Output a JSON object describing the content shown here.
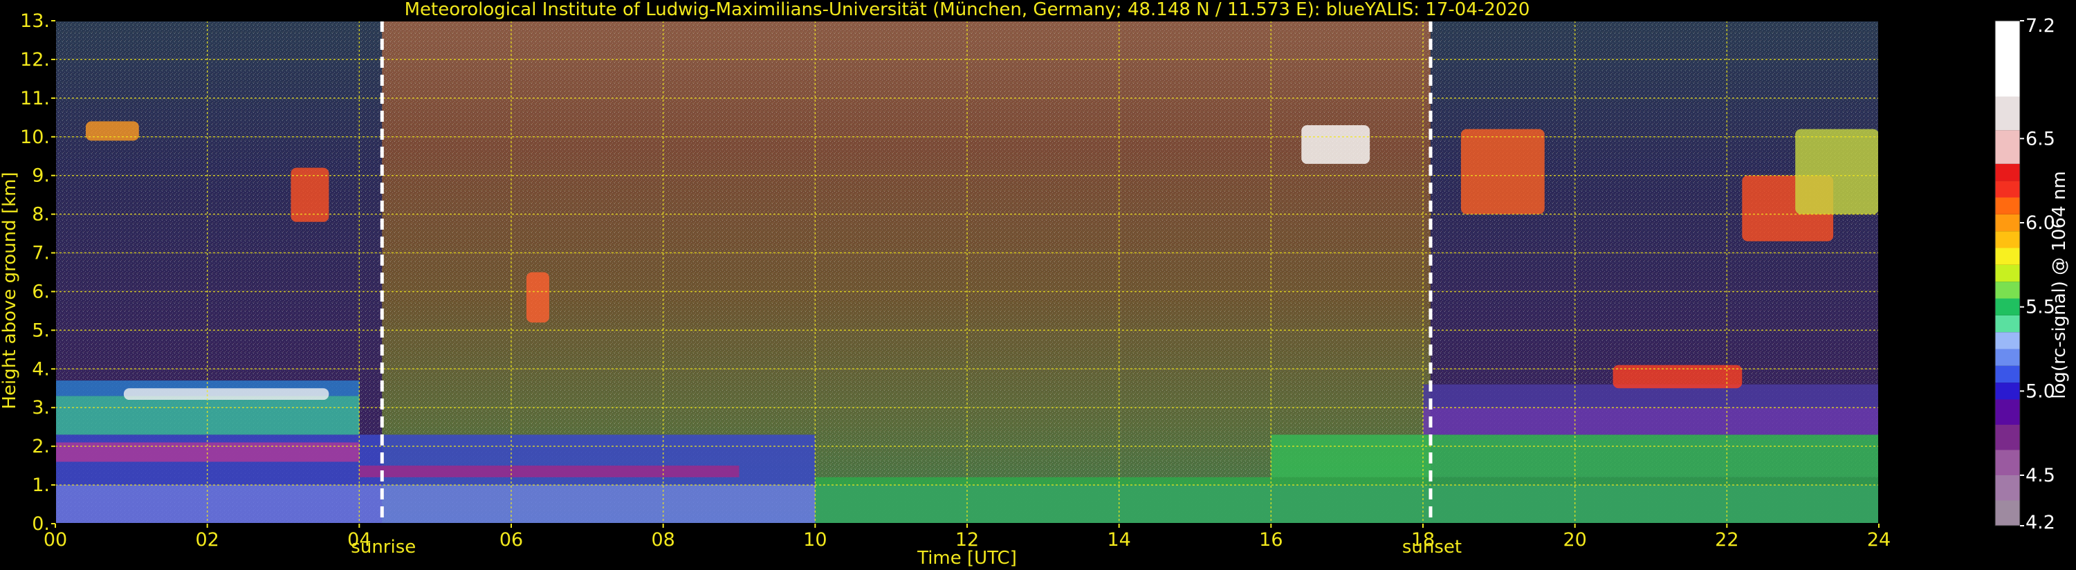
{
  "chart_data": {
    "type": "heatmap",
    "title": "Meteorological Institute of Ludwig-Maximilians-Universität (München, Germany; 48.148 N / 11.573 E):    blueYALIS: 17-04-2020",
    "xlabel": "Time [UTC]",
    "ylabel": "Height above ground [km]",
    "xlim": [
      0,
      24
    ],
    "ylim": [
      0,
      13
    ],
    "x_ticks": [
      "00",
      "02",
      "04",
      "06",
      "08",
      "10",
      "12",
      "14",
      "16",
      "18",
      "20",
      "22",
      "24"
    ],
    "y_ticks": [
      "0.",
      "1.",
      "2.",
      "3.",
      "4.",
      "5.",
      "6.",
      "7.",
      "8.",
      "9.",
      "10.",
      "11.",
      "12.",
      "13."
    ],
    "grid": true,
    "events": [
      {
        "label": "sunrise",
        "x": 4.3
      },
      {
        "label": "sunset",
        "x": 18.1
      }
    ],
    "colorbar": {
      "label": "log(rc-signal) @ 1064 nm",
      "range": [
        4.2,
        7.2
      ],
      "ticks": [
        "4.2",
        "4.5",
        "5.0",
        "5.5",
        "6.0",
        "6.5",
        "7.2"
      ]
    },
    "colors": {
      "text": "#f2e81c",
      "grid": "#f2e81c",
      "background": "#000000"
    }
  }
}
